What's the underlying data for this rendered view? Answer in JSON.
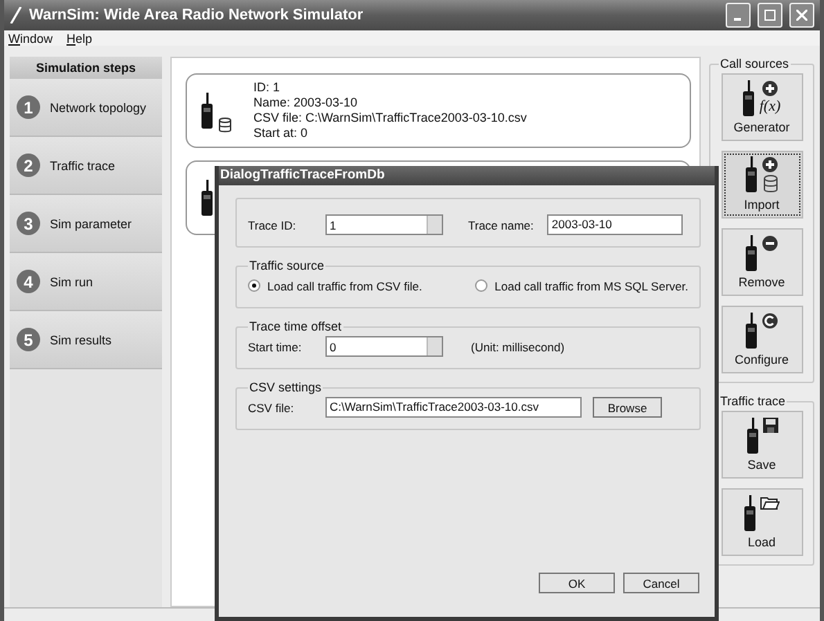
{
  "window": {
    "title": "WarnSim: Wide Area Radio Network Simulator"
  },
  "menu": [
    "Window",
    "Help"
  ],
  "sidebar": {
    "title": "Simulation steps",
    "steps": [
      {
        "number": "1",
        "label": "Network topology"
      },
      {
        "number": "2",
        "label": "Traffic trace"
      },
      {
        "number": "3",
        "label": "Sim parameter"
      },
      {
        "number": "4",
        "label": "Sim run"
      },
      {
        "number": "5",
        "label": "Sim results"
      }
    ]
  },
  "sources": [
    {
      "kind": "full",
      "lines": [
        "ID: 1",
        "Name: 2003-03-10",
        "CSV file: C:\\WarnSim\\TrafficTrace2003-03-10.csv",
        "Start at: 0"
      ]
    },
    {
      "kind": "covered"
    }
  ],
  "call_sources": {
    "title": "Call sources",
    "buttons": [
      {
        "label": "Generator",
        "kind": "function",
        "glyph": "f(x)",
        "focused": false
      },
      {
        "label": "Import",
        "kind": "database",
        "focused": true
      },
      {
        "label": "Remove",
        "kind": "remove",
        "focused": false
      },
      {
        "label": "Configure",
        "kind": "configure",
        "focused": false
      }
    ]
  },
  "traffic_trace": {
    "title": "Traffic trace",
    "buttons": [
      {
        "label": "Save",
        "kind": "save",
        "focused": false
      },
      {
        "label": "Load",
        "kind": "load",
        "focused": false
      }
    ]
  },
  "dialog": {
    "title": "DialogTrafficTraceFromDb",
    "trace_id": {
      "label": "Trace ID:",
      "value": "1"
    },
    "trace_name": {
      "label": "Trace name:",
      "value": "2003-03-10"
    },
    "traffic_source": {
      "title": "Traffic source",
      "options": [
        {
          "label": "Load call traffic from CSV file.",
          "selected": true
        },
        {
          "label": "Load call traffic from MS SQL Server.",
          "selected": false
        }
      ]
    },
    "time_offset": {
      "title": "Trace time offset",
      "label": "Start time:",
      "value": "0",
      "unit": "(Unit: millisecond)"
    },
    "csv": {
      "title": "CSV settings",
      "label": "CSV file:",
      "value": "C:\\WarnSim\\TrafficTrace2003-03-10.csv",
      "button": "Browse"
    },
    "buttons": [
      "OK",
      "Cancel"
    ]
  }
}
